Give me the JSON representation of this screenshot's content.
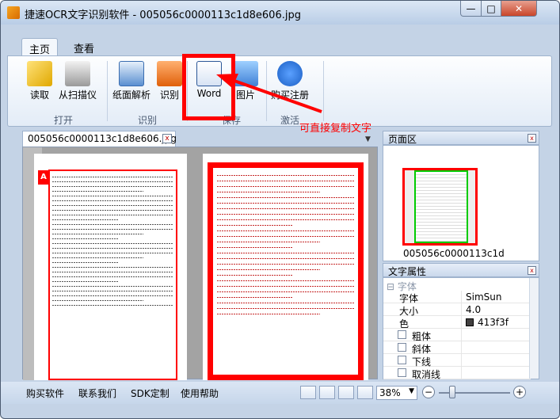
{
  "window": {
    "title": "捷速OCR文字识别软件 - 005056c0000113c1d8e606.jpg",
    "controls": {
      "minimize": "—",
      "maximize": "□",
      "close": "✕"
    }
  },
  "tabs": [
    {
      "label": "主页",
      "active": true
    },
    {
      "label": "查看",
      "active": false
    }
  ],
  "ribbon": {
    "buttons": {
      "read": {
        "label": "读取",
        "icon": "folder-open-icon"
      },
      "scan": {
        "label": "从扫描仪",
        "icon": "scanner-icon"
      },
      "analyze": {
        "label": "纸面解析",
        "icon": "layout-analyze-icon"
      },
      "recognize": {
        "label": "识别",
        "icon": "ocr-icon"
      },
      "word": {
        "label": "Word",
        "icon": "word-document-icon"
      },
      "image": {
        "label": "图片",
        "icon": "image-icon"
      },
      "register": {
        "label": "购买注册",
        "icon": "info-icon"
      }
    },
    "groups": {
      "open": "打开",
      "recognize": "识别",
      "save": "保存",
      "activate": "激活"
    }
  },
  "annotation": "可直接复制文字",
  "document": {
    "tab_label": "005056c0000113c1d8e606.jpg",
    "close_glyph": "x",
    "dropdown_glyph": "▼"
  },
  "side_panels": {
    "pages": {
      "title": "页面区",
      "thumbnail_label": "005056c0000113c1d"
    },
    "text_attributes": {
      "title": "文字属性",
      "category": "字体",
      "rows": [
        {
          "key": "字体",
          "value": "SimSun"
        },
        {
          "key": "大小",
          "value": "4.0"
        },
        {
          "key": "色",
          "value": "413f3f"
        }
      ],
      "checkboxes": [
        "粗体",
        "斜体",
        "下线",
        "取消线"
      ]
    }
  },
  "statusbar": {
    "links": [
      "购买软件",
      "联系我们",
      "SDK定制",
      "使用帮助"
    ],
    "zoom": "38%",
    "zoom_level_fraction": 0.38,
    "zoom_out": "−",
    "zoom_in": "+"
  },
  "colors": {
    "highlight": "#ff0000",
    "text_color_swatch": "#413f3f",
    "thumbnail_viewport": "#00cc00"
  }
}
